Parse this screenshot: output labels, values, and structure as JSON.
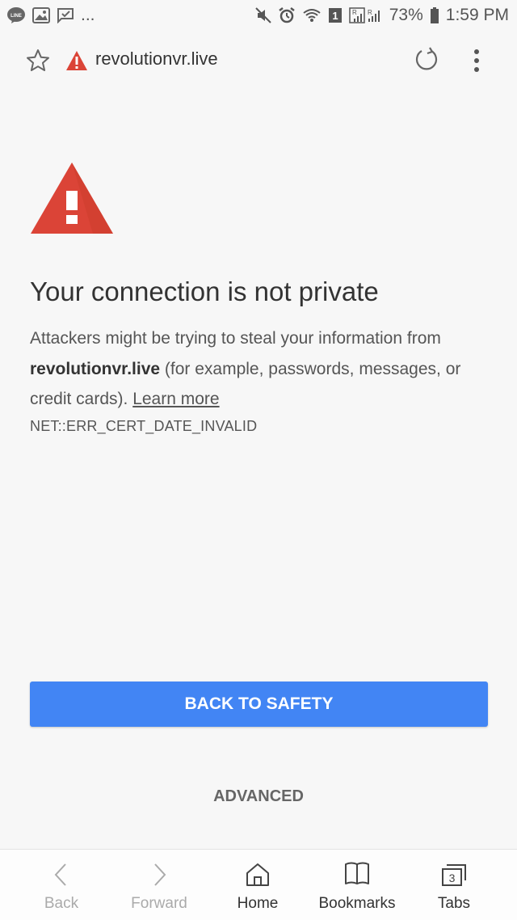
{
  "status_bar": {
    "left_icons": [
      "line-app-icon",
      "gallery-icon",
      "messaging-icon"
    ],
    "overflow": "...",
    "right_icons": [
      "mute-icon",
      "alarm-icon",
      "wifi-icon",
      "sim1-icon",
      "signal-icon"
    ],
    "sim_label": "1",
    "battery": "73%",
    "time": "1:59 PM"
  },
  "url_bar": {
    "url": "revolutionvr.live"
  },
  "interstitial": {
    "title": "Your connection is not private",
    "body_prefix": "Attackers might be trying to steal your information from ",
    "domain": "revolutionvr.live",
    "body_suffix": " (for example, passwords, messages, or credit cards). ",
    "learn_more": "Learn more",
    "error_code": "NET::ERR_CERT_DATE_INVALID",
    "primary_button": "BACK TO SAFETY",
    "secondary_button": "ADVANCED"
  },
  "bottom_nav": {
    "back": "Back",
    "forward": "Forward",
    "home": "Home",
    "bookmarks": "Bookmarks",
    "tabs": "Tabs",
    "tabs_count": "3"
  },
  "colors": {
    "warning_red": "#db4437",
    "button_blue": "#4285f4",
    "background": "#f7f7f7"
  }
}
